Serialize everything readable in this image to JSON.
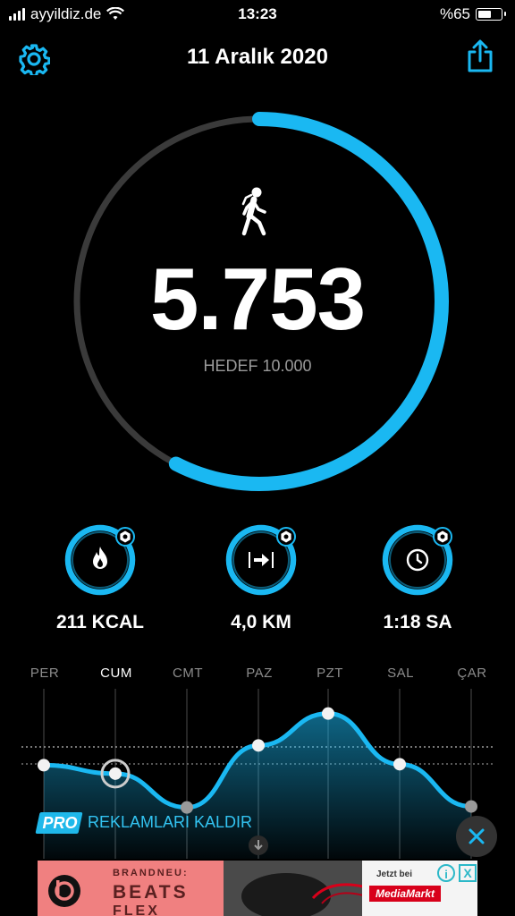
{
  "status_bar": {
    "carrier": "ayyildiz.de",
    "time": "13:23",
    "battery": "%65",
    "battery_level": 0.65
  },
  "header": {
    "title": "11 Aralık 2020",
    "settings_icon": "gear-icon",
    "share_icon": "share-icon"
  },
  "steps": {
    "value": "5.753",
    "goal_label": "HEDEF 10.000",
    "progress": 0.5753,
    "icon": "walking-person-icon",
    "accent": "#1ab8f2",
    "track": "#3a3a3a"
  },
  "stats": [
    {
      "icon": "flame-icon",
      "label": "211 KCAL"
    },
    {
      "icon": "distance-arrow-icon",
      "label": "4,0 KM"
    },
    {
      "icon": "clock-icon",
      "label": "1:18 SA"
    }
  ],
  "weekly_chart": {
    "days": [
      "PER",
      "CUM",
      "CMT",
      "PAZ",
      "PZT",
      "SAL",
      "ÇAR"
    ],
    "selected_day": "CUM",
    "values": [
      5200,
      4300,
      700,
      7300,
      10700,
      5300,
      800
    ],
    "goal": 10000
  },
  "pro_banner": {
    "badge": "PRO",
    "label": "REKLAMLARI KALDIR"
  },
  "ad": {
    "line1": "BRANDNEU:",
    "line2": "BEATS",
    "line3": "FLEX",
    "store_small": "Jetzt bei",
    "store": "MediaMarkt",
    "info": "i",
    "close": "X"
  }
}
